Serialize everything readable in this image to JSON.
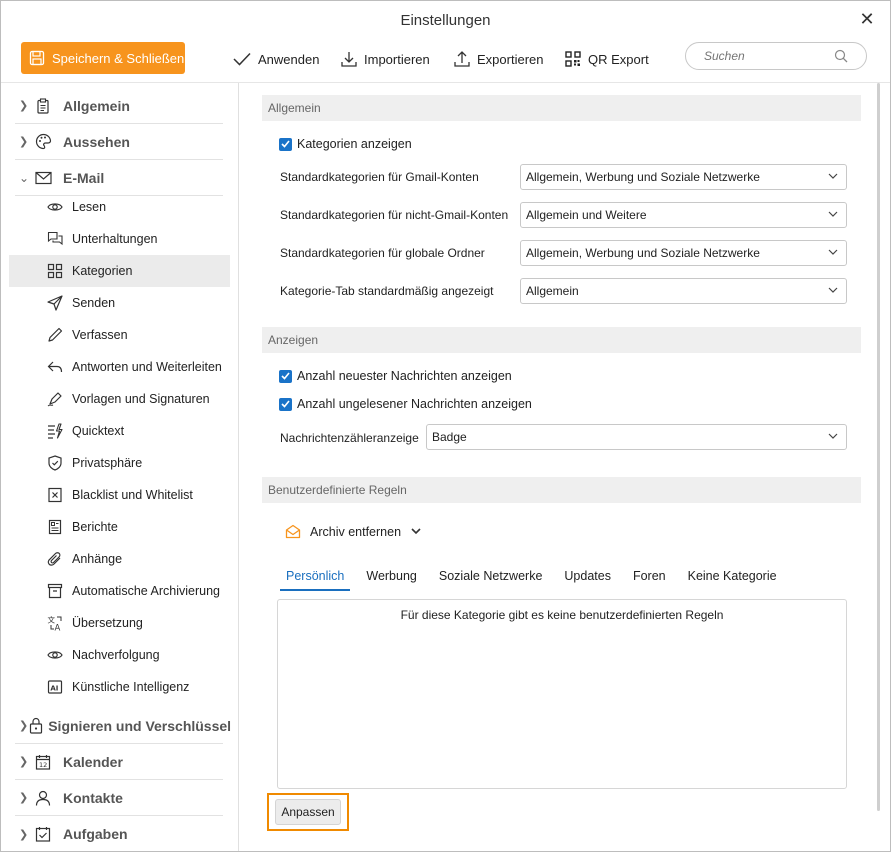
{
  "window": {
    "title": "Einstellungen"
  },
  "toolbar": {
    "save_close": "Speichern & Schließen",
    "apply": "Anwenden",
    "import": "Importieren",
    "export": "Exportieren",
    "qr_export": "QR Export",
    "search_placeholder": "Suchen"
  },
  "sidebar": {
    "sections": [
      {
        "label": "Allgemein",
        "icon": "clipboard-icon",
        "expanded": false
      },
      {
        "label": "Aussehen",
        "icon": "palette-icon",
        "expanded": false
      },
      {
        "label": "E-Mail",
        "icon": "envelope-icon",
        "expanded": true
      }
    ],
    "email_items": [
      {
        "label": "Lesen",
        "icon": "eye-icon"
      },
      {
        "label": "Unterhaltungen",
        "icon": "chat-icon"
      },
      {
        "label": "Kategorien",
        "icon": "grid-icon",
        "active": true
      },
      {
        "label": "Senden",
        "icon": "send-icon"
      },
      {
        "label": "Verfassen",
        "icon": "pencil-icon"
      },
      {
        "label": "Antworten und Weiterleiten",
        "icon": "reply-icon"
      },
      {
        "label": "Vorlagen und Signaturen",
        "icon": "signature-icon"
      },
      {
        "label": "Quicktext",
        "icon": "quicktext-icon"
      },
      {
        "label": "Privatsphäre",
        "icon": "shield-icon"
      },
      {
        "label": "Blacklist und Whitelist",
        "icon": "blacklist-icon"
      },
      {
        "label": "Berichte",
        "icon": "report-icon"
      },
      {
        "label": "Anhänge",
        "icon": "paperclip-icon"
      },
      {
        "label": "Automatische Archivierung",
        "icon": "archive-icon"
      },
      {
        "label": "Übersetzung",
        "icon": "translate-icon"
      },
      {
        "label": "Nachverfolgung",
        "icon": "tracking-eye-icon"
      },
      {
        "label": "Künstliche Intelligenz",
        "icon": "ai-icon"
      }
    ],
    "bottom_sections": [
      {
        "label": "Signieren und Verschlüssel",
        "icon": "lock-icon"
      },
      {
        "label": "Kalender",
        "icon": "calendar-icon"
      },
      {
        "label": "Kontakte",
        "icon": "person-icon"
      },
      {
        "label": "Aufgaben",
        "icon": "task-icon"
      }
    ]
  },
  "main": {
    "general": {
      "header": "Allgemein",
      "show_categories": {
        "label": "Kategorien anzeigen",
        "checked": true
      },
      "rows": [
        {
          "label": "Standardkategorien für Gmail-Konten",
          "value": "Allgemein, Werbung und Soziale Netzwerke"
        },
        {
          "label": "Standardkategorien für nicht-Gmail-Konten",
          "value": "Allgemein und Weitere"
        },
        {
          "label": "Standardkategorien für globale Ordner",
          "value": "Allgemein, Werbung und Soziale Netzwerke"
        },
        {
          "label": "Kategorie-Tab standardmäßig angezeigt",
          "value": "Allgemein"
        }
      ]
    },
    "display": {
      "header": "Anzeigen",
      "checkboxes": [
        {
          "label": "Anzahl neuester Nachrichten anzeigen",
          "checked": true
        },
        {
          "label": "Anzahl ungelesener Nachrichten anzeigen",
          "checked": true
        }
      ],
      "counter_label": "Nachrichtenzähleranzeige",
      "counter_value": "Badge"
    },
    "custom_rules": {
      "header": "Benutzerdefinierte Regeln",
      "dropdown_label": "Archiv entfernen",
      "tabs": [
        "Persönlich",
        "Werbung",
        "Soziale Netzwerke",
        "Updates",
        "Foren",
        "Keine Kategorie"
      ],
      "active_tab": "Persönlich",
      "empty_text": "Für diese Kategorie gibt es keine benutzerdefinierten Regeln",
      "adjust_button": "Anpassen"
    }
  },
  "colors": {
    "accent": "#f7941d",
    "tab_active": "#1a6fbf",
    "checkbox": "#1a73c8"
  }
}
